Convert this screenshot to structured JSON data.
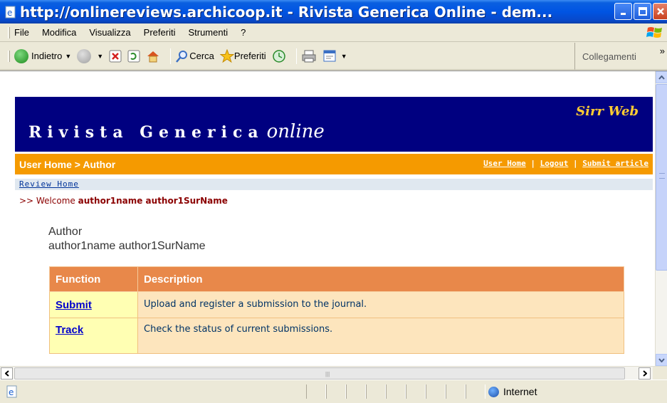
{
  "window": {
    "title": "http://onlinereviews.archicoop.it - Rivista Generica Online - dem..."
  },
  "menu": [
    "File",
    "Modifica",
    "Visualizza",
    "Preferiti",
    "Strumenti",
    "?"
  ],
  "toolbar": {
    "back_label": "Indietro",
    "search_label": "Cerca",
    "favorites_label": "Preferiti",
    "links_label": "Collegamenti",
    "more_label": "»"
  },
  "header": {
    "brand": "Rivista Generica",
    "brand_italic": "online",
    "sirr": "Sirr Web"
  },
  "nav": {
    "breadcrumb": "User Home > Author",
    "links": [
      "User Home",
      "Logout",
      "Submit article"
    ],
    "separator": "|"
  },
  "review_home": "Review Home",
  "welcome": {
    "prefix": ">> Welcome",
    "name": "author1name author1SurName"
  },
  "role": "Author",
  "user": "author1name author1SurName",
  "table": {
    "headers": [
      "Function",
      "Description"
    ],
    "rows": [
      {
        "function": "Submit",
        "description": "Upload and register a submission to the journal."
      },
      {
        "function": "Track",
        "description": "Check the status of current submissions."
      }
    ]
  },
  "status": {
    "zone": "Internet"
  },
  "colors": {
    "header_bg": "#000080",
    "nav_bg": "#f59a00",
    "table_header": "#e8884a"
  }
}
